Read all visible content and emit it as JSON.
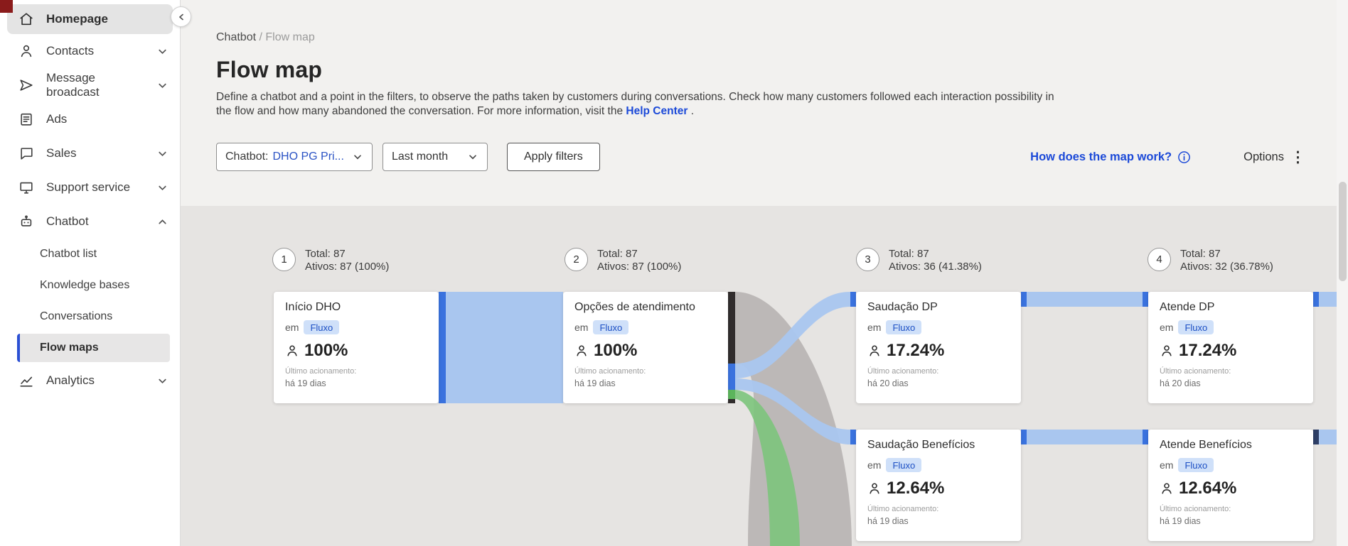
{
  "sidebar": {
    "items": [
      {
        "label": "Homepage",
        "icon": "home-icon",
        "selected": true
      },
      {
        "label": "Contacts",
        "icon": "person-icon",
        "chevron": "down"
      },
      {
        "label": "Message broadcast",
        "icon": "send-icon",
        "chevron": "down"
      },
      {
        "label": "Ads",
        "icon": "document-icon"
      },
      {
        "label": "Sales",
        "icon": "chat-bubble-icon",
        "chevron": "down"
      },
      {
        "label": "Support service",
        "icon": "monitor-icon",
        "chevron": "down"
      },
      {
        "label": "Chatbot",
        "icon": "robot-icon",
        "chevron": "up",
        "expanded": true,
        "children": [
          {
            "label": "Chatbot list"
          },
          {
            "label": "Knowledge bases"
          },
          {
            "label": "Conversations"
          },
          {
            "label": "Flow maps",
            "selected": true
          }
        ]
      },
      {
        "label": "Analytics",
        "icon": "line-chart-icon",
        "chevron": "down"
      }
    ]
  },
  "breadcrumb": {
    "parent": "Chatbot",
    "separator": "/",
    "current": "Flow map"
  },
  "page": {
    "title": "Flow map",
    "description_line1": "Define a chatbot and a point in the filters, to observe the paths taken by customers during conversations. Check how many customers followed each interaction possibility in",
    "description_line2": "the flow and how many abandoned the conversation. For more information, visit the",
    "help_link": "Help Center",
    "description_end": "."
  },
  "filters": {
    "chatbot_label": "Chatbot:",
    "chatbot_value": "DHO PG Pri...",
    "period_value": "Last month",
    "apply_label": "Apply filters",
    "map_help_label": "How does the map work?",
    "options_label": "Options"
  },
  "flow": {
    "columns": [
      {
        "number": "1",
        "total": "Total: 87",
        "active": "Ativos: 87 (100%)"
      },
      {
        "number": "2",
        "total": "Total: 87",
        "active": "Ativos: 87 (100%)"
      },
      {
        "number": "3",
        "total": "Total: 87",
        "active": "Ativos: 36 (41.38%)"
      },
      {
        "number": "4",
        "total": "Total: 87",
        "active": "Ativos: 32 (36.78%)"
      }
    ],
    "cards": [
      {
        "title": "Início DHO",
        "prefix": "em",
        "badge": "Fluxo",
        "percent": "100%",
        "last_label": "Último acionamento:",
        "last_value": "há 19 dias"
      },
      {
        "title": "Opções de atendimento",
        "prefix": "em",
        "badge": "Fluxo",
        "percent": "100%",
        "last_label": "Último acionamento:",
        "last_value": "há 19 dias"
      },
      {
        "title": "Saudação DP",
        "prefix": "em",
        "badge": "Fluxo",
        "percent": "17.24%",
        "last_label": "Último acionamento:",
        "last_value": "há 20 dias"
      },
      {
        "title": "Atende DP",
        "prefix": "em",
        "badge": "Fluxo",
        "percent": "17.24%",
        "last_label": "Último acionamento:",
        "last_value": "há 20 dias"
      },
      {
        "title": "Saudação Benefícios",
        "prefix": "em",
        "badge": "Fluxo",
        "percent": "12.64%",
        "last_label": "Último acionamento:",
        "last_value": "há 19 dias"
      },
      {
        "title": "Atende Benefícios",
        "prefix": "em",
        "badge": "Fluxo",
        "percent": "12.64%",
        "last_label": "Último acionamento:",
        "last_value": "há 19 dias"
      }
    ]
  },
  "colors": {
    "accent_blue": "#1b49d8",
    "badge_bg": "#cfe0f9",
    "badge_text": "#1c4fc4",
    "flow_bar_blue": "#3a72de",
    "flow_ribbon_blue": "#a9c6ef",
    "flow_ribbon_gray": "#b6b2b1",
    "flow_ribbon_green": "#7cc47c",
    "flow_bar_dark": "#312d2d",
    "logo_red": "#8a1b1b"
  }
}
